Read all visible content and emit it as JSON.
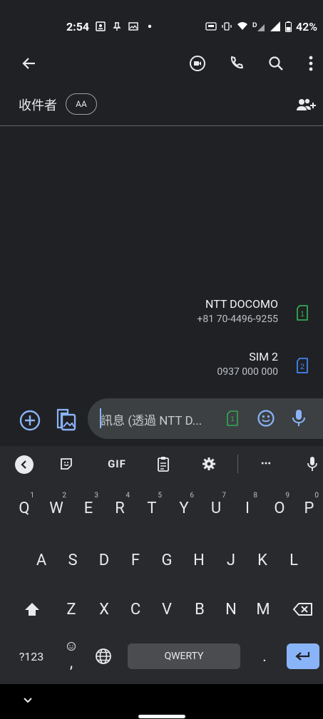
{
  "status_bar": {
    "time": "2:54",
    "battery": "42%"
  },
  "app_bar": {
    "icons": [
      "back-arrow-icon",
      "video-call-icon",
      "phone-icon",
      "search-icon",
      "more-vert-icon"
    ]
  },
  "recipients": {
    "label": "收件者",
    "chip": "AA"
  },
  "sim_options": [
    {
      "name": "NTT DOCOMO",
      "number": "+81 70-4496-9255",
      "slot": "1",
      "color": "#34a853"
    },
    {
      "name": "SIM 2",
      "number": "0937 000 000",
      "slot": "2",
      "color": "#4285f4"
    }
  ],
  "compose": {
    "text": "訊息 (透過 NTT D..."
  },
  "keyboard": {
    "toolbar": {
      "gif": "GIF",
      "more": "•••"
    },
    "row1": [
      "Q",
      "W",
      "E",
      "R",
      "T",
      "Y",
      "U",
      "I",
      "O",
      "P"
    ],
    "row1_hints": [
      "1",
      "2",
      "3",
      "4",
      "5",
      "6",
      "7",
      "8",
      "9",
      "0"
    ],
    "row2": [
      "A",
      "S",
      "D",
      "F",
      "G",
      "H",
      "J",
      "K",
      "L"
    ],
    "row3": [
      "Z",
      "X",
      "C",
      "V",
      "B",
      "N",
      "M"
    ],
    "symbols": "?123",
    "comma": ",",
    "space": "QWERTY",
    "period": "."
  }
}
